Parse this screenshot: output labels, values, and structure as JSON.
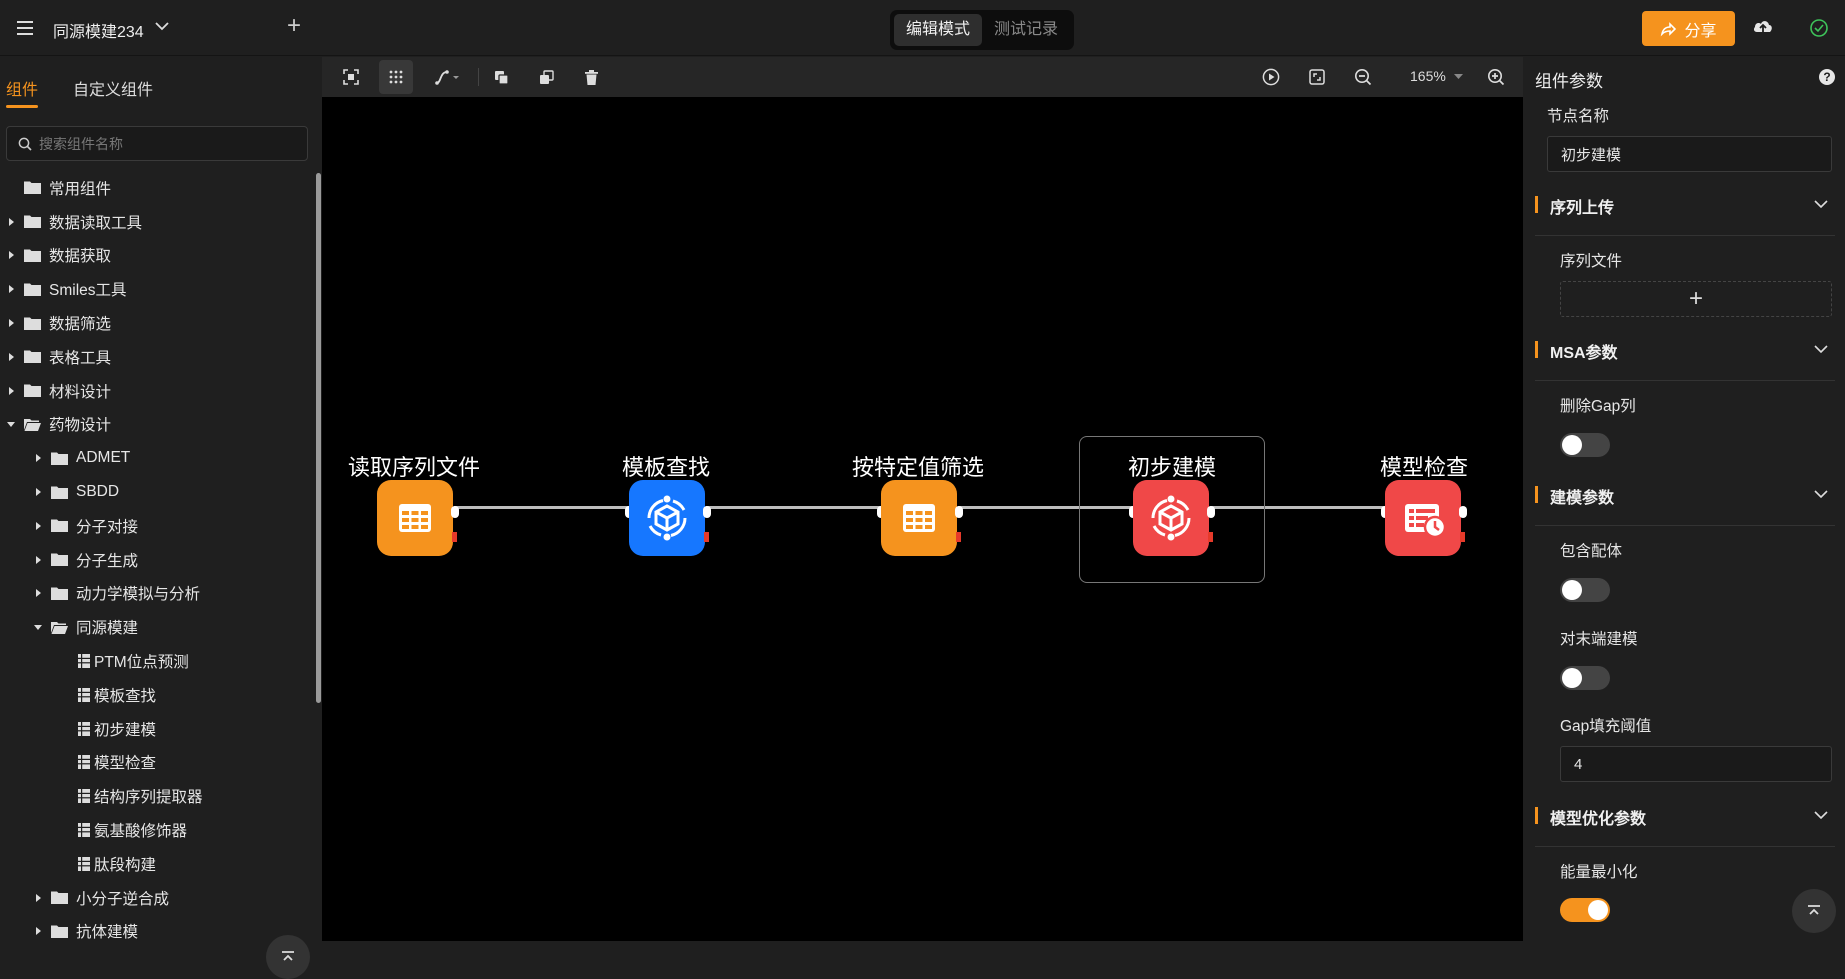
{
  "header": {
    "project_title": "同源模建234",
    "mode_tabs": [
      "编辑模式",
      "测试记录"
    ],
    "active_mode": "编辑模式",
    "share_label": "分享",
    "accent_color": "#f5931e"
  },
  "sidebar": {
    "tabs": [
      "组件",
      "自定义组件"
    ],
    "search_placeholder": "搜索组件名称",
    "tree": [
      {
        "label": "常用组件",
        "type": "folder",
        "level": 0,
        "expanded": null
      },
      {
        "label": "数据读取工具",
        "type": "folder",
        "level": 0,
        "expanded": false
      },
      {
        "label": "数据获取",
        "type": "folder",
        "level": 0,
        "expanded": false
      },
      {
        "label": "Smiles工具",
        "type": "folder",
        "level": 0,
        "expanded": false
      },
      {
        "label": "数据筛选",
        "type": "folder",
        "level": 0,
        "expanded": false
      },
      {
        "label": "表格工具",
        "type": "folder",
        "level": 0,
        "expanded": false
      },
      {
        "label": "材料设计",
        "type": "folder",
        "level": 0,
        "expanded": false
      },
      {
        "label": "药物设计",
        "type": "folder",
        "level": 0,
        "expanded": true
      },
      {
        "label": "ADMET",
        "type": "folder",
        "level": 1,
        "expanded": false
      },
      {
        "label": "SBDD",
        "type": "folder",
        "level": 1,
        "expanded": false
      },
      {
        "label": "分子对接",
        "type": "folder",
        "level": 1,
        "expanded": false
      },
      {
        "label": "分子生成",
        "type": "folder",
        "level": 1,
        "expanded": false
      },
      {
        "label": "动力学模拟与分析",
        "type": "folder",
        "level": 1,
        "expanded": false
      },
      {
        "label": "同源模建",
        "type": "folder",
        "level": 1,
        "expanded": true
      },
      {
        "label": "PTM位点预测",
        "type": "leaf",
        "level": 2
      },
      {
        "label": "模板查找",
        "type": "leaf",
        "level": 2
      },
      {
        "label": "初步建模",
        "type": "leaf",
        "level": 2
      },
      {
        "label": "模型检查",
        "type": "leaf",
        "level": 2
      },
      {
        "label": "结构序列提取器",
        "type": "leaf",
        "level": 2
      },
      {
        "label": "氨基酸修饰器",
        "type": "leaf",
        "level": 2
      },
      {
        "label": "肽段构建",
        "type": "leaf",
        "level": 2
      },
      {
        "label": "小分子逆合成",
        "type": "folder",
        "level": 1,
        "expanded": false
      },
      {
        "label": "抗体建模",
        "type": "folder",
        "level": 1,
        "expanded": false
      }
    ]
  },
  "canvas": {
    "zoom": "165%",
    "nodes": [
      {
        "label": "读取序列文件",
        "color": "#f5931e",
        "icon": "table-grid-icon"
      },
      {
        "label": "模板查找",
        "color": "#1677ff",
        "icon": "cube-cycle-icon"
      },
      {
        "label": "按特定值筛选",
        "color": "#f5931e",
        "icon": "table-grid-icon"
      },
      {
        "label": "初步建模",
        "color": "#f04848",
        "icon": "cube-cycle-icon"
      },
      {
        "label": "模型检查",
        "color": "#f04848",
        "icon": "list-clock-icon"
      }
    ]
  },
  "panel": {
    "title": "组件参数",
    "node_name_label": "节点名称",
    "node_name_value": "初步建模",
    "sections": {
      "seq_upload": "序列上传",
      "msa": "MSA参数",
      "build": "建模参数",
      "opt": "模型优化参数"
    },
    "seq_file_label": "序列文件",
    "delete_gap_label": "删除Gap列",
    "delete_gap": false,
    "include_ligand_label": "包含配体",
    "include_ligand": false,
    "terminal_label": "对末端建模",
    "terminal": false,
    "gap_threshold_label": "Gap填充阈值",
    "gap_threshold_value": "4",
    "energy_min_label": "能量最小化",
    "energy_min": true
  }
}
